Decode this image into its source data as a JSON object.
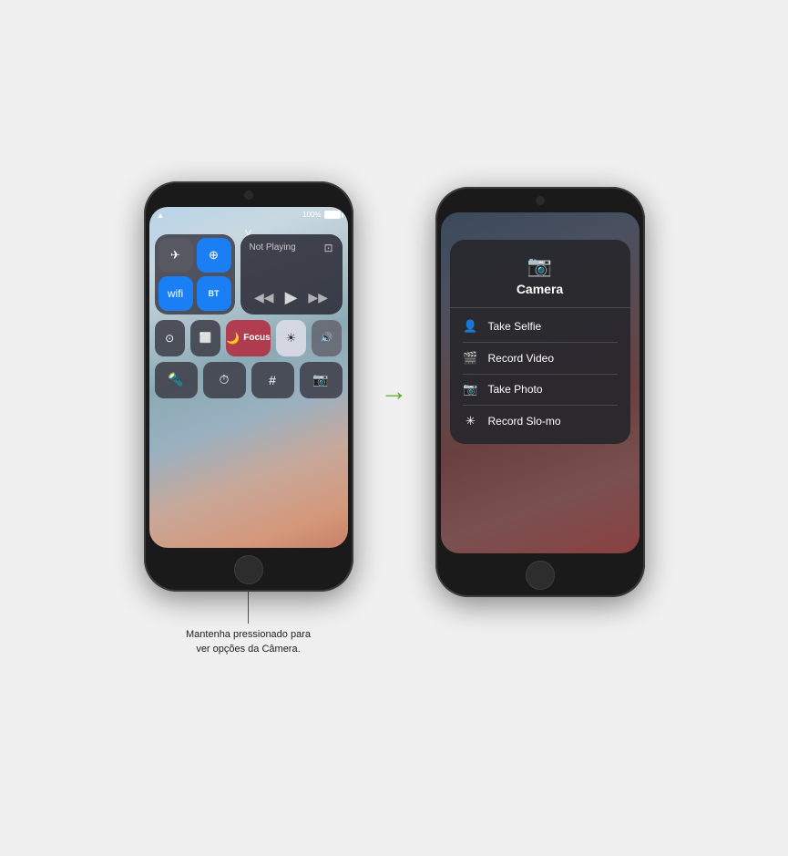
{
  "scene": {
    "arrow": "→",
    "callout_text": "Mantenha pressionado para\nver opções da Câmera."
  },
  "iphone_left": {
    "status": {
      "battery_pct": "100%",
      "wifi": "wifi"
    },
    "control_center": {
      "swipe_indicator": "˅",
      "network": {
        "airplane_icon": "✈",
        "airdrop_icon": "⊕",
        "wifi_icon": "wifi",
        "bluetooth_icon": "Bluetooth"
      },
      "media": {
        "title": "Not Playing",
        "airplay_icon": "airplay",
        "prev_icon": "«",
        "play_icon": "▶",
        "next_icon": "»"
      },
      "orientation_icon": "⊙",
      "mirror_icon": "⬜",
      "focus_icon": "🌙",
      "focus_label": "Focus",
      "brightness_icon": "☀",
      "volume_icon": "🔊",
      "flashlight_icon": "🔦",
      "timer_icon": "⏱",
      "calculator_icon": "⌨",
      "camera_icon": "📷"
    }
  },
  "iphone_right": {
    "camera_popup": {
      "icon": "📷",
      "title": "Camera",
      "items": [
        {
          "icon": "👤",
          "label": "Take Selfie"
        },
        {
          "icon": "🎬",
          "label": "Record Video"
        },
        {
          "icon": "📷",
          "label": "Take Photo"
        },
        {
          "icon": "✳",
          "label": "Record Slo-mo"
        }
      ]
    }
  }
}
